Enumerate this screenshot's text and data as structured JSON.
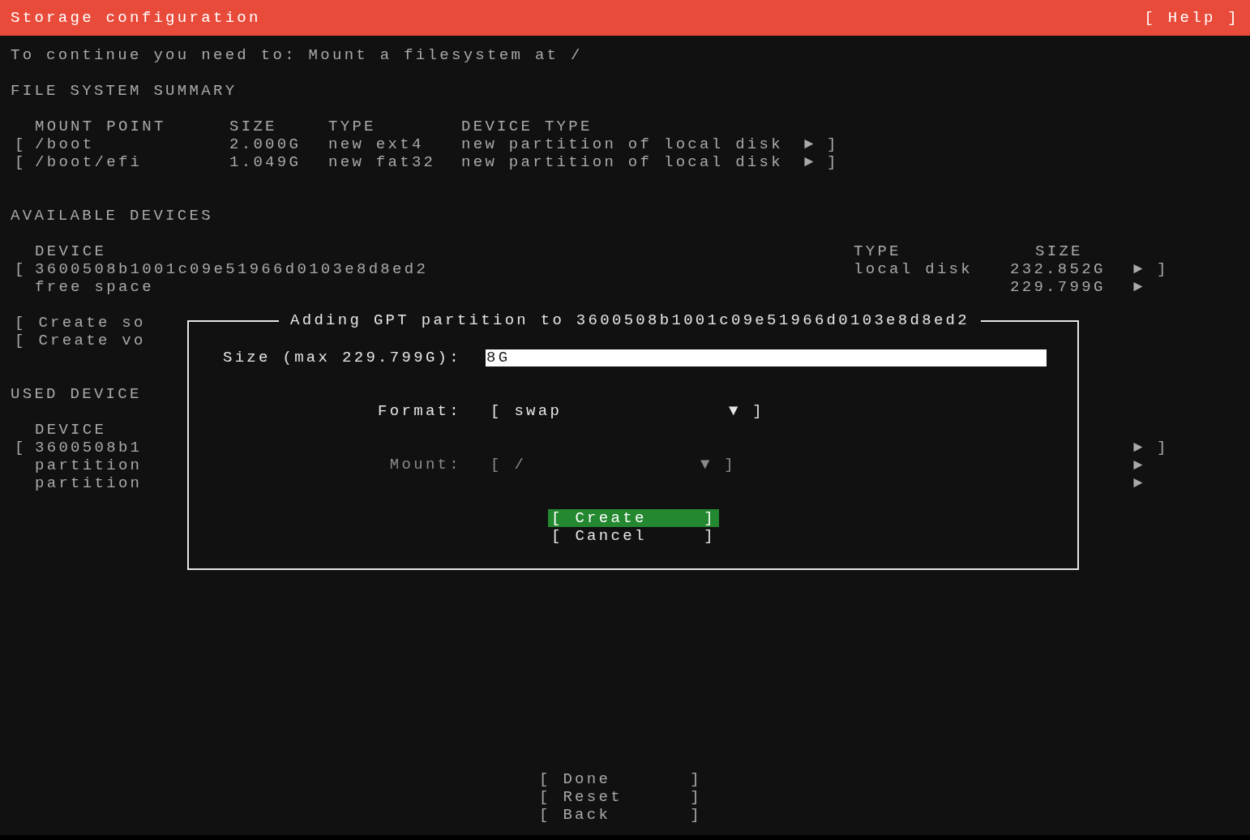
{
  "header": {
    "title": "Storage configuration",
    "help": "[ Help ]"
  },
  "notice": "To continue you need to: Mount a filesystem at /",
  "file_system_summary": {
    "title": "FILE SYSTEM SUMMARY",
    "columns": [
      "MOUNT POINT",
      "SIZE",
      "TYPE",
      "DEVICE TYPE"
    ],
    "rows": [
      {
        "open": "[",
        "mount_point": "/boot",
        "size": "2.000G",
        "type": "new ext4",
        "device_type": "new partition of local disk",
        "arrow": "►",
        "close": "]"
      },
      {
        "open": "[",
        "mount_point": "/boot/efi",
        "size": "1.049G",
        "type": "new fat32",
        "device_type": "new partition of local disk",
        "arrow": "►",
        "close": "]"
      }
    ]
  },
  "available_devices": {
    "title": "AVAILABLE DEVICES",
    "columns": [
      "DEVICE",
      "TYPE",
      "SIZE"
    ],
    "rows": [
      {
        "open": "[",
        "device": "3600508b1001c09e51966d0103e8d8ed2",
        "type": "local disk",
        "size": "232.852G",
        "arrow": "►",
        "close": "]"
      },
      {
        "device": "free space",
        "size": "229.799G",
        "arrow": "►"
      }
    ],
    "actions": [
      "[ Create so",
      "[ Create vo"
    ]
  },
  "used_devices": {
    "title": "USED DEVICE",
    "columns": [
      "DEVICE"
    ],
    "rows": [
      {
        "open": "[",
        "device": "3600508b1",
        "arrow": "►",
        "close": "]"
      },
      {
        "device": "partition",
        "arrow": "►"
      },
      {
        "device": "partition",
        "arrow": "►"
      }
    ]
  },
  "dialog": {
    "title": "Adding GPT partition to 3600508b1001c09e51966d0103e8d8ed2",
    "fields": [
      {
        "kind": "text",
        "label": "Size (max 229.799G):",
        "value": "8G",
        "disabled": false
      },
      {
        "kind": "select",
        "label": "Format:",
        "open": "[",
        "value": "swap",
        "caret": "▼",
        "close": "]",
        "disabled": false
      },
      {
        "kind": "select",
        "label": "Mount:",
        "open": "[",
        "value": "/",
        "caret": "▼",
        "close": "]",
        "disabled": true
      }
    ],
    "buttons": [
      {
        "open": "[",
        "label": "Create",
        "close": "]",
        "selected": true
      },
      {
        "open": "[",
        "label": "Cancel",
        "close": "]",
        "selected": false
      }
    ]
  },
  "footer_buttons": [
    {
      "open": "[",
      "label": "Done",
      "close": "]"
    },
    {
      "open": "[",
      "label": "Reset",
      "close": "]"
    },
    {
      "open": "[",
      "label": "Back",
      "close": "]"
    }
  ]
}
